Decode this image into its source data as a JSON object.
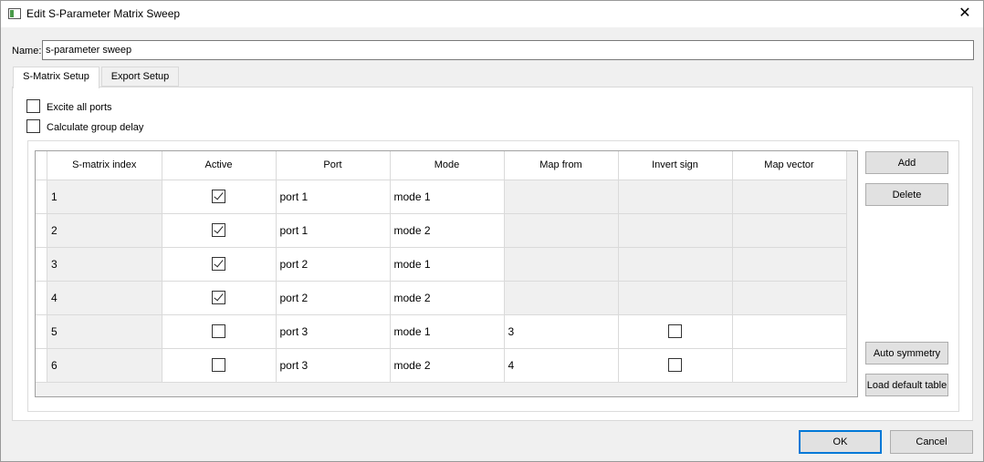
{
  "window": {
    "title": "Edit S-Parameter Matrix Sweep",
    "close_glyph": "✕"
  },
  "name": {
    "label": "Name:",
    "value": "s-parameter sweep"
  },
  "tabs": [
    {
      "label": "S-Matrix Setup",
      "active": true
    },
    {
      "label": "Export Setup",
      "active": false
    }
  ],
  "options": [
    {
      "label": "Excite all ports",
      "checked": false
    },
    {
      "label": "Calculate group delay",
      "checked": false
    }
  ],
  "table": {
    "columns": [
      "S-matrix index",
      "Active",
      "Port",
      "Mode",
      "Map from",
      "Invert sign",
      "Map vector"
    ],
    "rows": [
      {
        "index": "1",
        "active": true,
        "port": "port 1",
        "mode": "mode 1",
        "map_from": "",
        "invert_sign": null,
        "map_vector": ""
      },
      {
        "index": "2",
        "active": true,
        "port": "port 1",
        "mode": "mode 2",
        "map_from": "",
        "invert_sign": null,
        "map_vector": ""
      },
      {
        "index": "3",
        "active": true,
        "port": "port 2",
        "mode": "mode 1",
        "map_from": "",
        "invert_sign": null,
        "map_vector": ""
      },
      {
        "index": "4",
        "active": true,
        "port": "port 2",
        "mode": "mode 2",
        "map_from": "",
        "invert_sign": null,
        "map_vector": ""
      },
      {
        "index": "5",
        "active": false,
        "port": "port 3",
        "mode": "mode 1",
        "map_from": "3",
        "invert_sign": false,
        "map_vector": ""
      },
      {
        "index": "6",
        "active": false,
        "port": "port 3",
        "mode": "mode 2",
        "map_from": "4",
        "invert_sign": false,
        "map_vector": ""
      }
    ]
  },
  "side_buttons": {
    "add": "Add",
    "delete": "Delete",
    "auto_symmetry": "Auto symmetry",
    "load_default": "Load default table"
  },
  "footer": {
    "ok": "OK",
    "cancel": "Cancel"
  },
  "colors": {
    "accent": "#0078d7",
    "disabled_cell": "#f0f0f0"
  }
}
